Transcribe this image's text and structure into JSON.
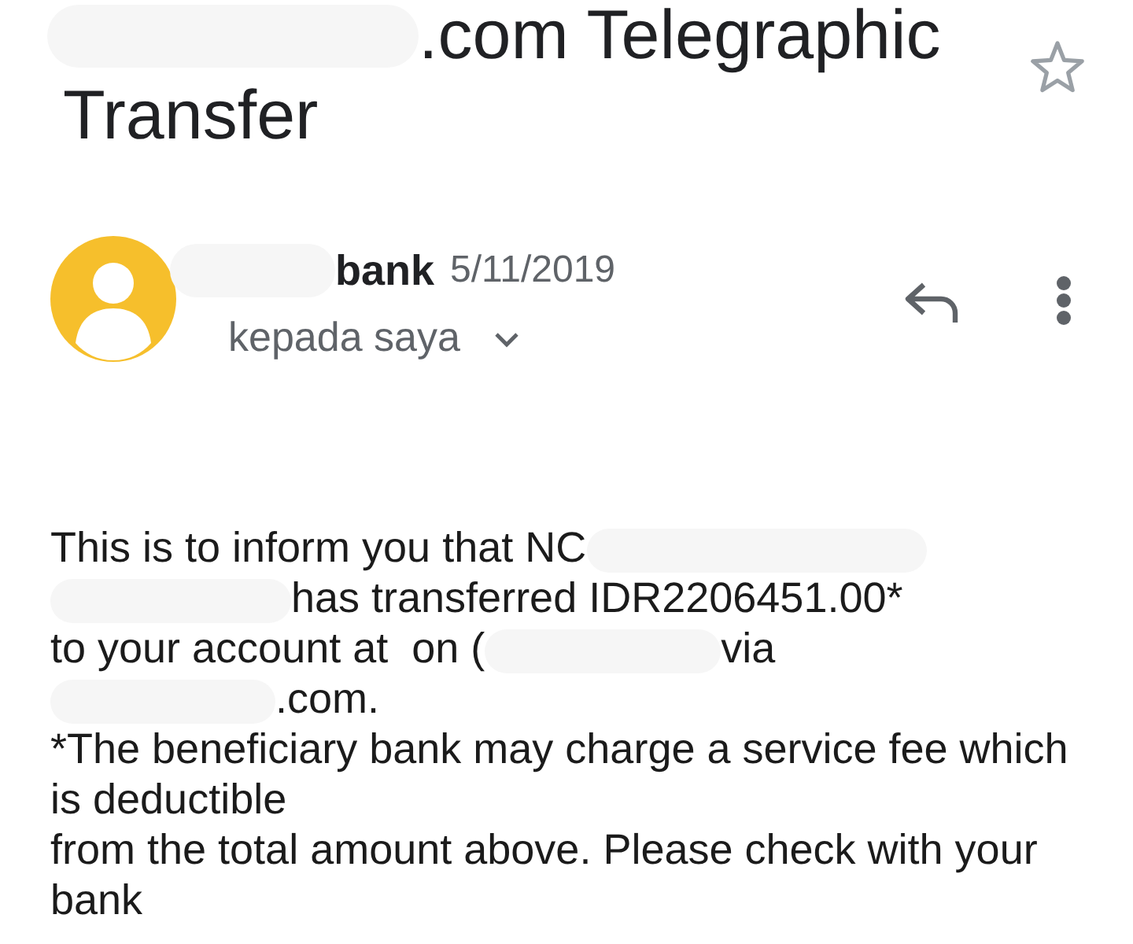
{
  "subject": {
    "lines": [
      {
        "segments": [
          {
            "kind": "redacted"
          },
          {
            "kind": "text",
            "text": ".com Telegraphic"
          }
        ]
      },
      {
        "segments": [
          {
            "kind": "text",
            "text": "Transfer"
          }
        ]
      }
    ]
  },
  "starred": false,
  "message": {
    "sender": {
      "segments": [
        {
          "kind": "redacted"
        },
        {
          "kind": "text",
          "text": "bank"
        }
      ]
    },
    "date": "5/11/2019",
    "recipient": "kepada saya",
    "recipient_expanded": false
  },
  "body": {
    "lines": [
      {
        "segments": [
          {
            "kind": "text",
            "text": "This is to inform you that NC"
          },
          {
            "kind": "redacted"
          }
        ]
      },
      {
        "segments": [
          {
            "kind": "redacted"
          },
          {
            "kind": "text",
            "text": "has transferred IDR2206451.00*"
          }
        ]
      },
      {
        "segments": [
          {
            "kind": "text",
            "text": "to your account at  on ("
          },
          {
            "kind": "redacted"
          },
          {
            "kind": "text",
            "text": "via"
          }
        ]
      },
      {
        "segments": [
          {
            "kind": "redacted"
          },
          {
            "kind": "text",
            "text": ".com."
          }
        ]
      },
      {
        "segments": [
          {
            "kind": "text",
            "text": "*The beneficiary bank may charge a service fee which is deductible"
          }
        ]
      },
      {
        "segments": [
          {
            "kind": "text",
            "text": "from the total amount above. Please check with your bank"
          }
        ]
      }
    ]
  }
}
